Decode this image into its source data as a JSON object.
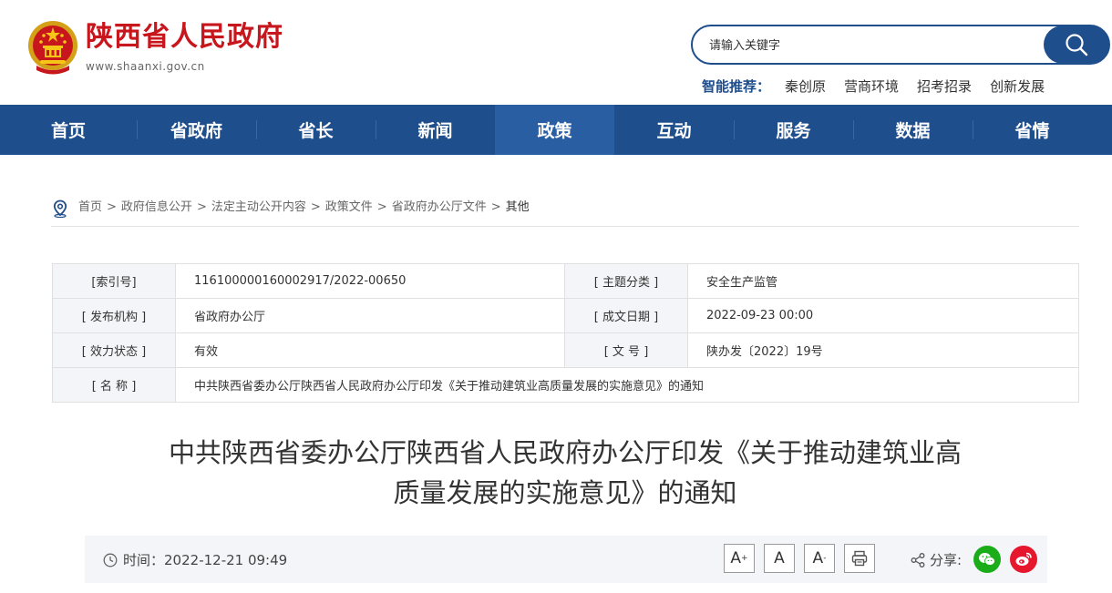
{
  "header": {
    "site_title": "陕西省人民政府",
    "domain": "www.shaanxi.gov.cn",
    "search_placeholder": "请输入关键字",
    "smart_label": "智能推荐：",
    "smart_links": [
      "秦创原",
      "营商环境",
      "招考招录",
      "创新发展"
    ]
  },
  "nav": {
    "items": [
      "首页",
      "省政府",
      "省长",
      "新闻",
      "政策",
      "互动",
      "服务",
      "数据",
      "省情"
    ],
    "active": "政策"
  },
  "breadcrumb": [
    "首页",
    "政府信息公开",
    "法定主动公开内容",
    "政策文件",
    "省政府办公厅文件",
    "其他"
  ],
  "meta": {
    "index_no_label": "[索引号]",
    "index_no": "116100000160002917/2022-00650",
    "topic_label": "[ 主题分类 ]",
    "topic": "安全生产监管",
    "issuer_label": "[ 发布机构 ]",
    "issuer": "省政府办公厅",
    "date_label": "[ 成文日期 ]",
    "date": "2022-09-23 00:00",
    "status_label": "[ 效力状态 ]",
    "status": "有效",
    "docno_label": "[ 文 号 ]",
    "docno": "陕办发〔2022〕19号",
    "name_label": "[ 名 称 ]",
    "name": "中共陕西省委办公厅陕西省人民政府办公厅印发《关于推动建筑业高质量发展的实施意见》的通知"
  },
  "article": {
    "title_line1": "中共陕西省委办公厅陕西省人民政府办公厅印发《关于推动建筑业高",
    "title_line2": "质量发展的实施意见》的通知",
    "time_label": "时间：",
    "time": "2022-12-21 09:49",
    "font_increase": "A",
    "font_increase_sup": "+",
    "font_reset": "A",
    "font_decrease": "A",
    "font_decrease_sup": "-",
    "share_label": "分享:"
  },
  "colors": {
    "brand_red": "#c8161d",
    "nav_blue": "#1f4e8c",
    "wechat_green": "#1aad19",
    "weibo_red": "#e6162d"
  },
  "icons": [
    "emblem-icon",
    "search-icon",
    "location-pin-icon",
    "clock-icon",
    "print-icon",
    "share-icon",
    "wechat-icon",
    "weibo-icon"
  ]
}
